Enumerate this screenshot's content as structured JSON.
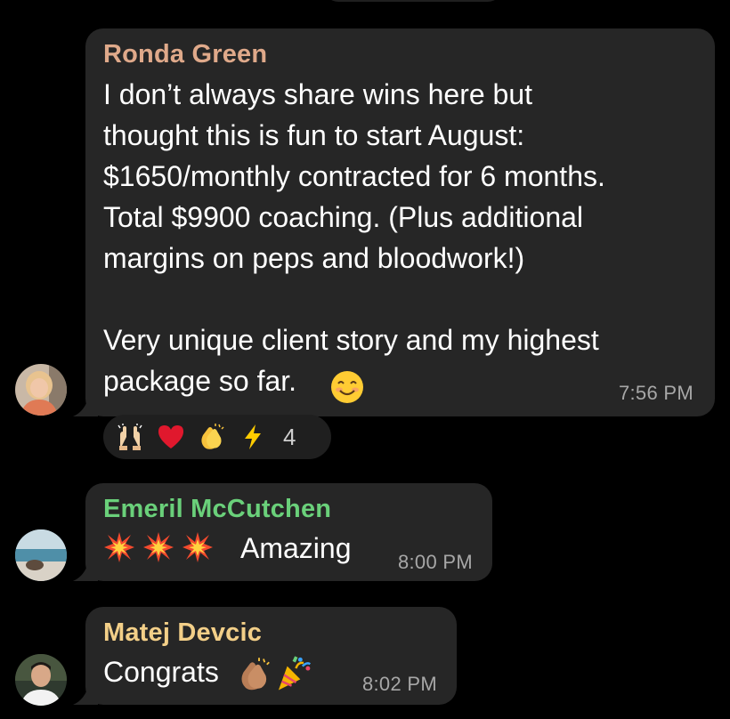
{
  "messages": [
    {
      "sender": "Ronda Green",
      "sender_color": "#dfa98a",
      "text": "I don’t always share wins here but\nthought this is fun to start August:\n$1650/monthly contracted for 6 months.\nTotal $9900 coaching. (Plus additional\nmargins on peps and bloodwork!)\n\nVery unique client story and my highest\npackage so far.",
      "trailing_emoji": "smiling-face-icon",
      "time": "7:56 PM",
      "reactions": {
        "icons": [
          "raising-hands-icon",
          "red-heart-icon",
          "clapping-hands-icon",
          "lightning-icon"
        ],
        "count": "4"
      }
    },
    {
      "sender": "Emeril McCutchen",
      "sender_color": "#6ad07a",
      "leading_emoji": [
        "collision-icon",
        "collision-icon",
        "collision-icon"
      ],
      "text": "Amazing",
      "time": "8:00 PM"
    },
    {
      "sender": "Matej Devcic",
      "sender_color": "#f3cf88",
      "text": "Congrats",
      "trailing_emoji": [
        "clapping-hands-icon",
        "party-popper-icon"
      ],
      "time": "8:02 PM"
    }
  ],
  "colors": {
    "background": "#000000",
    "bubble": "#262626",
    "timestamp": "#a7a7a7"
  }
}
